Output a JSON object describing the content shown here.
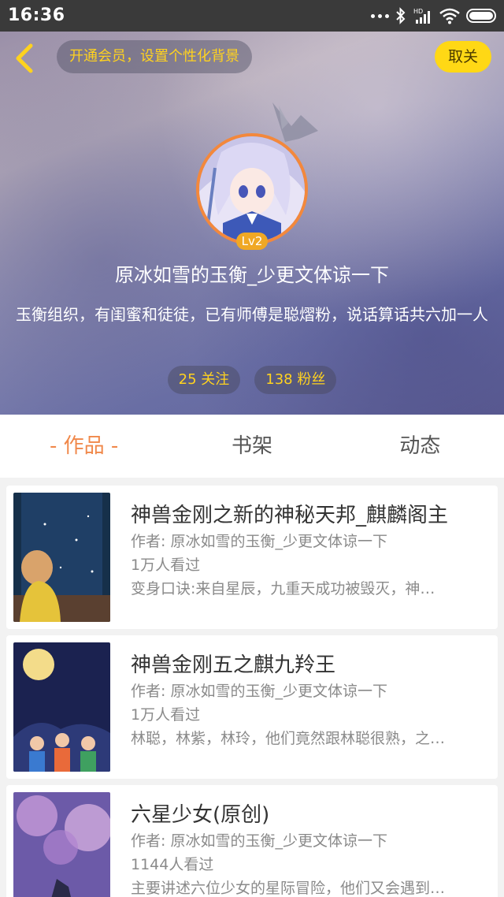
{
  "status_bar": {
    "time": "16:36"
  },
  "header": {
    "vip_prompt": "开通会员，设置个性化背景",
    "unfollow_label": "取关",
    "level": "Lv2",
    "username": "原冰如雪的玉衡_少更文体谅一下",
    "bio": "玉衡组织，有闺蜜和徒徒，已有师傅是聪熠粉，说话算话共六加一人",
    "following": "25 关注",
    "followers": "138 粉丝"
  },
  "tabs": [
    {
      "label": "- 作品 -"
    },
    {
      "label": "书架"
    },
    {
      "label": "动态"
    }
  ],
  "books": [
    {
      "title": "神兽金刚之新的神秘天邦_麒麟阁主",
      "author": "作者: 原冰如雪的玉衡_少更文体谅一下",
      "views": "1万人看过",
      "summary": "变身口诀:来自星辰，九重天成功被毁灭，神…"
    },
    {
      "title": "神兽金刚五之麒九羚王",
      "author": "作者: 原冰如雪的玉衡_少更文体谅一下",
      "views": "1万人看过",
      "summary": "林聪，林紫，林玲，他们竟然跟林聪很熟，之…"
    },
    {
      "title": "六星少女(原创)",
      "author": "作者: 原冰如雪的玉衡_少更文体谅一下",
      "views": "1144人看过",
      "summary": "主要讲述六位少女的星际冒险，他们又会遇到…"
    }
  ],
  "colors": {
    "accent": "#f0884a",
    "vip_yellow": "#ffd815",
    "level_badge": "#f0a825"
  }
}
